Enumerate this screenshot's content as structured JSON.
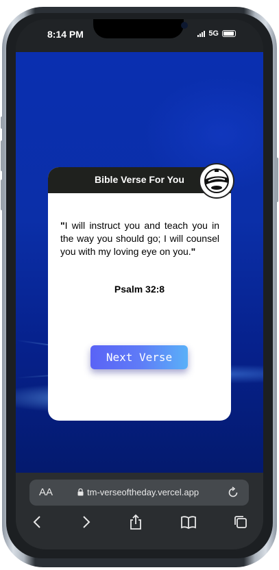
{
  "status_bar": {
    "time": "8:14 PM",
    "network": "5G"
  },
  "card": {
    "title": "Bible Verse For You",
    "logo_name": "timothy-logo",
    "verse_open_quote": "\"",
    "verse_text": "I will instruct you and teach you in the way you should go; I will counsel you with my loving eye on you.",
    "verse_close_quote": "\"",
    "reference": "Psalm 32:8",
    "next_button_label": "Next Verse"
  },
  "browser": {
    "text_size_label": "AA",
    "url": "tm-verseoftheday.vercel.app",
    "nav_icons": [
      "back-icon",
      "forward-icon",
      "share-icon",
      "bookmarks-icon",
      "tabs-icon"
    ]
  },
  "colors": {
    "page_background": "#0a2fb0",
    "card_header": "#1f211e",
    "button_gradient_start": "#5a63f6",
    "button_gradient_end": "#5ab0f8"
  }
}
